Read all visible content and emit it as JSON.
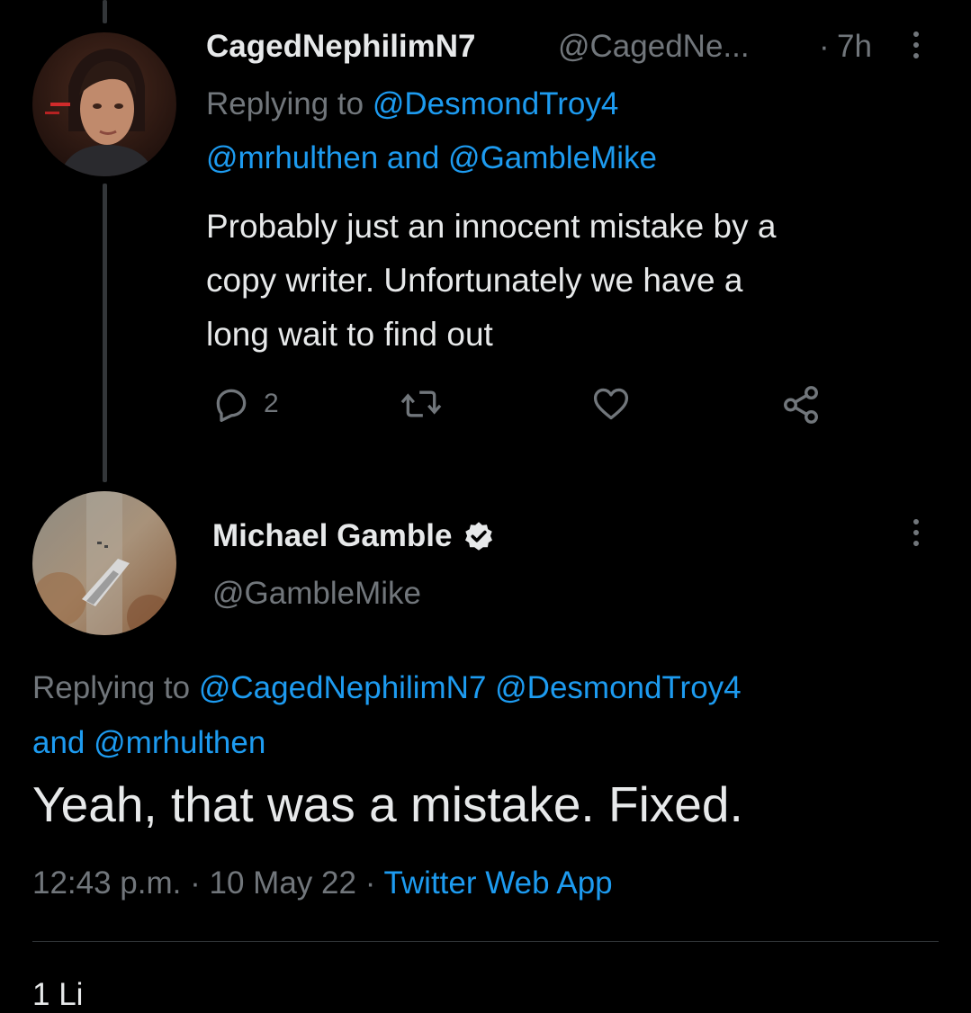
{
  "reply_tweet": {
    "display_name": "CagedNephilimN7",
    "handle": "@CagedNe...",
    "separator": "·",
    "time": "7h",
    "replying_prefix": "Replying to",
    "replying_to_1": "@DesmondTroy4",
    "replying_to_2": "@mrhulthen",
    "replying_and": "and",
    "replying_to_3": "@GambleMike",
    "body_lines": [
      "Probably just an innocent mistake by a",
      "copy writer. Unfortunately we have a",
      "long wait to find out"
    ],
    "reply_count": "2"
  },
  "main_tweet": {
    "display_name": "Michael Gamble",
    "handle": "@GambleMike",
    "replying_prefix": "Replying to",
    "replying_to_1": "@CagedNephilimN7",
    "replying_to_2": "@DesmondTroy4",
    "replying_and": "and",
    "replying_to_3": "@mrhulthen",
    "body": "Yeah, that was a mistake. Fixed.",
    "time": "12:43 p.m.",
    "separator": "·",
    "date": "10 May 22",
    "source": "Twitter Web App",
    "likes_partial": "1 Li"
  },
  "colors": {
    "background": "#000000",
    "text": "#e7e9ea",
    "muted": "#71767b",
    "link": "#1d9bf0"
  }
}
